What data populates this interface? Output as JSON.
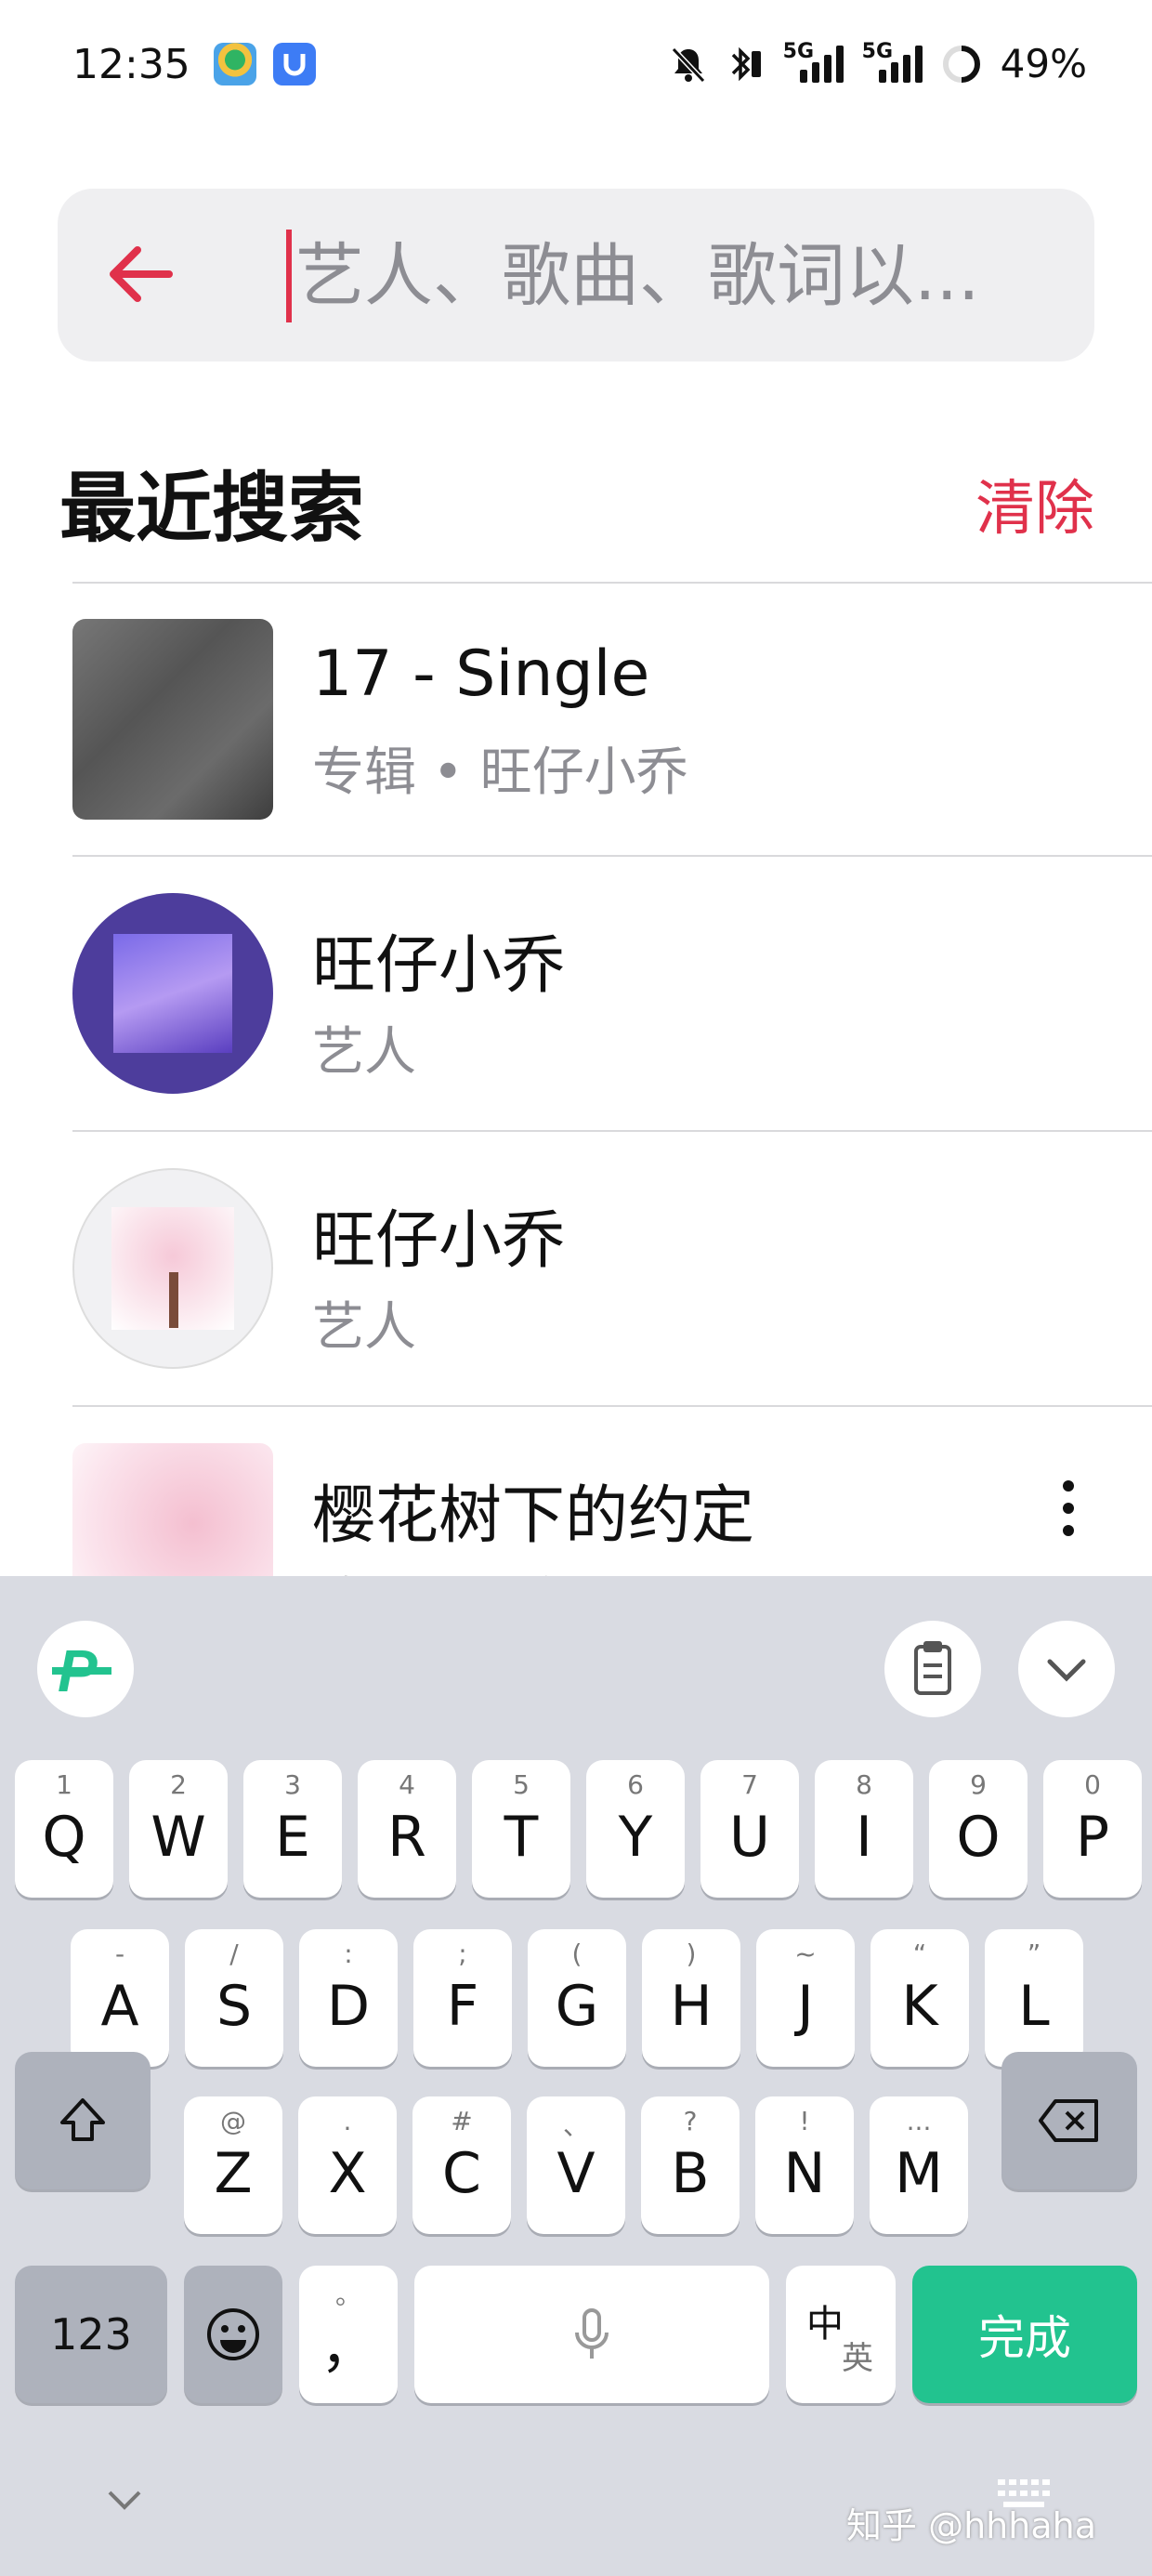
{
  "status_bar": {
    "time": "12:35",
    "battery": "49%",
    "signal1_label": "5G",
    "signal2_label": "5G"
  },
  "search": {
    "placeholder": "艺人、歌曲、歌词以..."
  },
  "recent": {
    "title": "最近搜索",
    "clear_label": "清除",
    "items": [
      {
        "title": "17 - Single",
        "subtitle": "专辑 • 旺仔小乔"
      },
      {
        "title": "旺仔小乔",
        "subtitle": "艺人"
      },
      {
        "title": "旺仔小乔",
        "subtitle": "艺人"
      },
      {
        "title": "樱花树下的约定",
        "subtitle": "歌曲 • 旺仔小乔"
      }
    ]
  },
  "keyboard": {
    "row1": [
      {
        "main": "Q",
        "hint": "1"
      },
      {
        "main": "W",
        "hint": "2"
      },
      {
        "main": "E",
        "hint": "3"
      },
      {
        "main": "R",
        "hint": "4"
      },
      {
        "main": "T",
        "hint": "5"
      },
      {
        "main": "Y",
        "hint": "6"
      },
      {
        "main": "U",
        "hint": "7"
      },
      {
        "main": "I",
        "hint": "8"
      },
      {
        "main": "O",
        "hint": "9"
      },
      {
        "main": "P",
        "hint": "0"
      }
    ],
    "row2": [
      {
        "main": "A",
        "hint": "-"
      },
      {
        "main": "S",
        "hint": "/"
      },
      {
        "main": "D",
        "hint": ":"
      },
      {
        "main": "F",
        "hint": ";"
      },
      {
        "main": "G",
        "hint": "("
      },
      {
        "main": "H",
        "hint": ")"
      },
      {
        "main": "J",
        "hint": "~"
      },
      {
        "main": "K",
        "hint": "“"
      },
      {
        "main": "L",
        "hint": "”"
      }
    ],
    "row3": [
      {
        "main": "Z",
        "hint": "@"
      },
      {
        "main": "X",
        "hint": "."
      },
      {
        "main": "C",
        "hint": "#"
      },
      {
        "main": "V",
        "hint": "、"
      },
      {
        "main": "B",
        "hint": "?"
      },
      {
        "main": "N",
        "hint": "!"
      },
      {
        "main": "M",
        "hint": "..."
      }
    ],
    "num_label": "123",
    "comma_label": "，",
    "comma_hint": "。",
    "lang_main": "中",
    "lang_sub": "英",
    "done_label": "完成"
  },
  "watermark": "知乎 @hhhaha",
  "colors": {
    "accent": "#e0314b",
    "done": "#22c38f"
  }
}
